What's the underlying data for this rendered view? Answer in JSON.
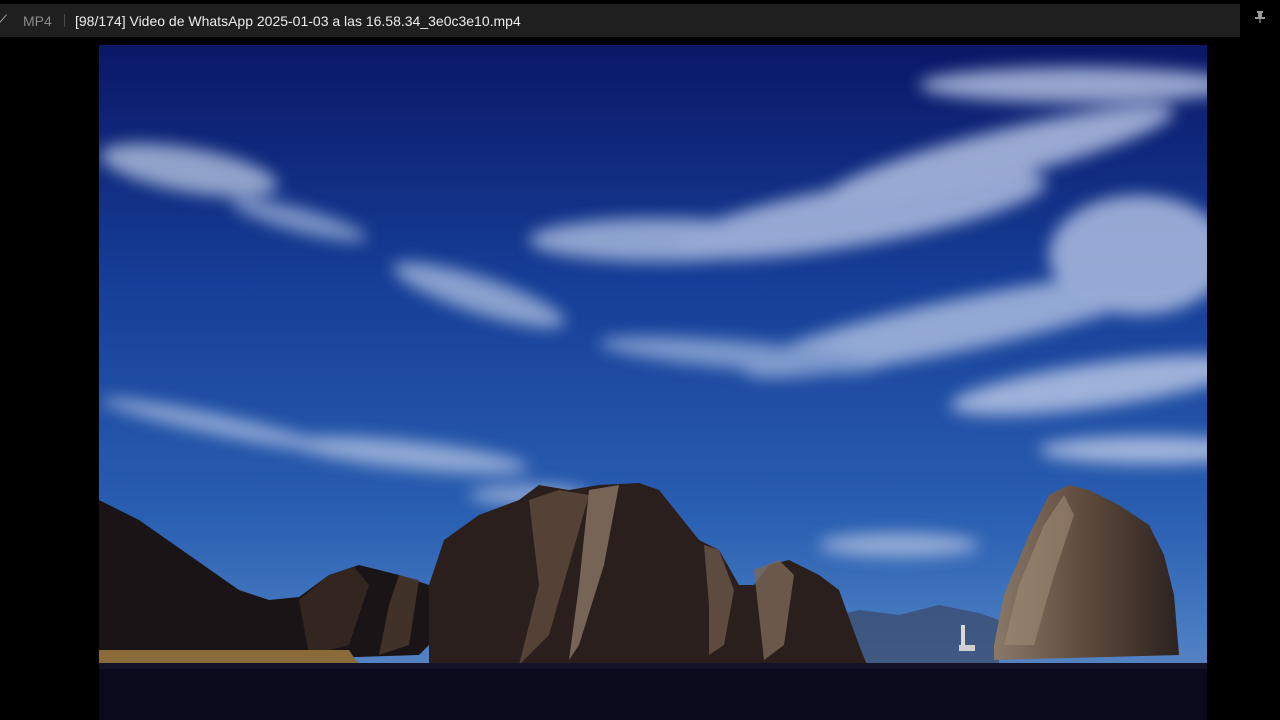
{
  "titlebar": {
    "back_glyph": "⟋",
    "format_label": "MP4",
    "file_title": "[98/174] Video de WhatsApp 2025-01-03 a las 16.58.34_3e0c3e10.mp4",
    "pin_icon": "pin-icon"
  },
  "viewer": {
    "content": "video-frame",
    "colors": {
      "sky_top": "#0a1a66",
      "sky_mid": "#1d4aa3",
      "sky_low": "#3d73c0",
      "rock": "#2a1c18",
      "water": "#0c0a1a"
    }
  }
}
